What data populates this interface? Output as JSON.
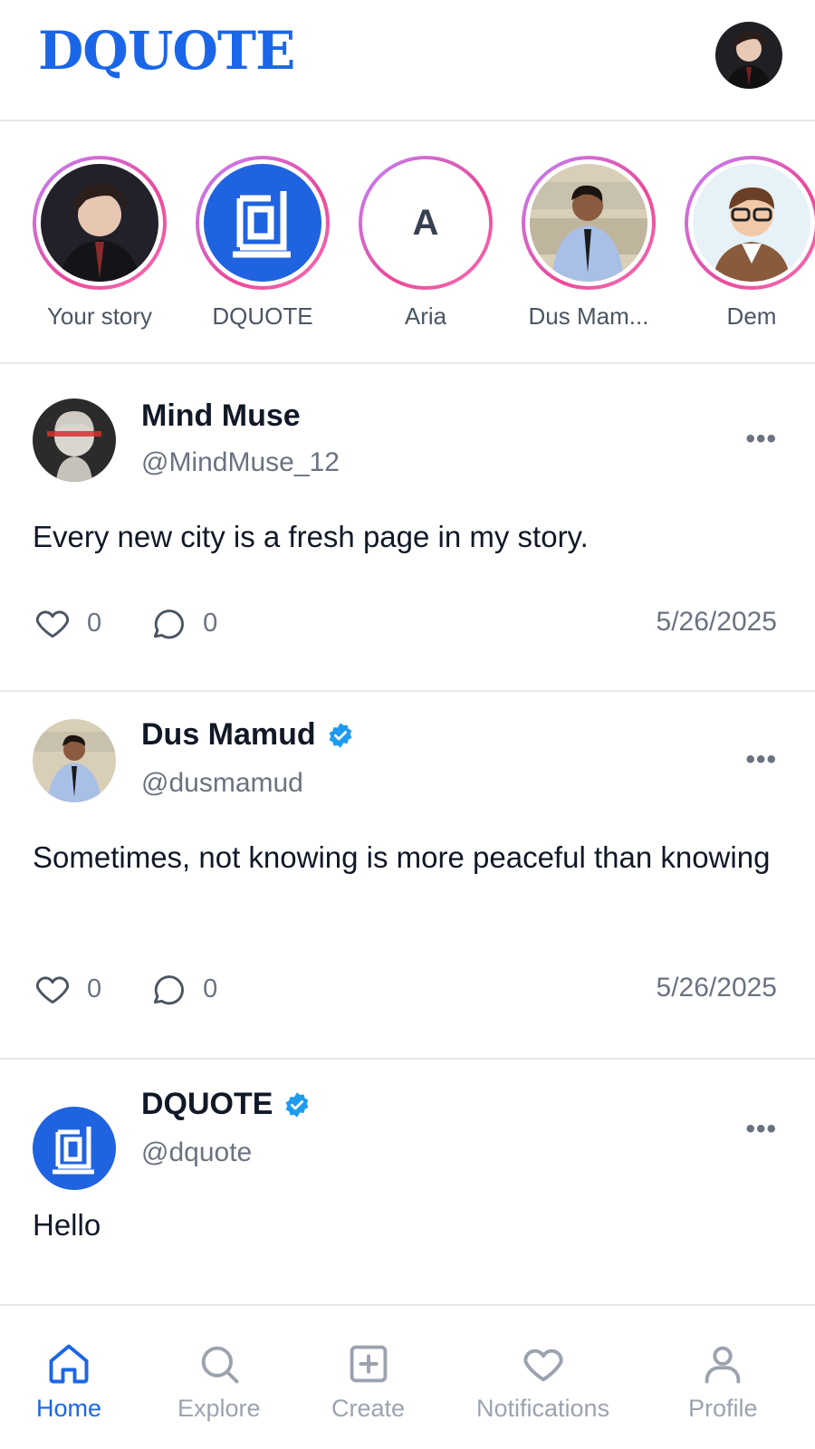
{
  "header": {
    "logo": "DQUOTE",
    "avatar_icon": "user-avatar"
  },
  "stories": [
    {
      "label": "Your story",
      "pic": "anime-portrait"
    },
    {
      "label": "DQUOTE",
      "pic": "dquote-logo"
    },
    {
      "label": "Aria",
      "pic": "letter",
      "letter": "A"
    },
    {
      "label": "Dus Mam...",
      "pic": "photo-man"
    },
    {
      "label": "Dem",
      "pic": "cartoon-man"
    }
  ],
  "posts": [
    {
      "name": "Mind Muse",
      "handle": "@MindMuse_12",
      "verified": false,
      "text": "Every new city is a fresh page in my story.",
      "likes": "0",
      "comments": "0",
      "date": "5/26/2025",
      "menu": "•••"
    },
    {
      "name": "Dus Mamud",
      "handle": "@dusmamud",
      "verified": true,
      "text": "Sometimes, not knowing is more peaceful than knowing",
      "likes": "0",
      "comments": "0",
      "date": "5/26/2025",
      "menu": "•••"
    },
    {
      "name": "DQUOTE",
      "handle": "@dquote",
      "verified": true,
      "text": "Hello",
      "menu": "•••"
    }
  ],
  "nav": [
    {
      "label": "Home",
      "icon": "home-icon",
      "active": true
    },
    {
      "label": "Explore",
      "icon": "search-icon",
      "active": false
    },
    {
      "label": "Create",
      "icon": "plus-square-icon",
      "active": false
    },
    {
      "label": "Notifications",
      "icon": "heart-icon",
      "active": false
    },
    {
      "label": "Profile",
      "icon": "user-icon",
      "active": false
    }
  ],
  "colors": {
    "brand": "#1a66e8",
    "verified": "#1d9bf0",
    "muted": "#6b7280"
  }
}
